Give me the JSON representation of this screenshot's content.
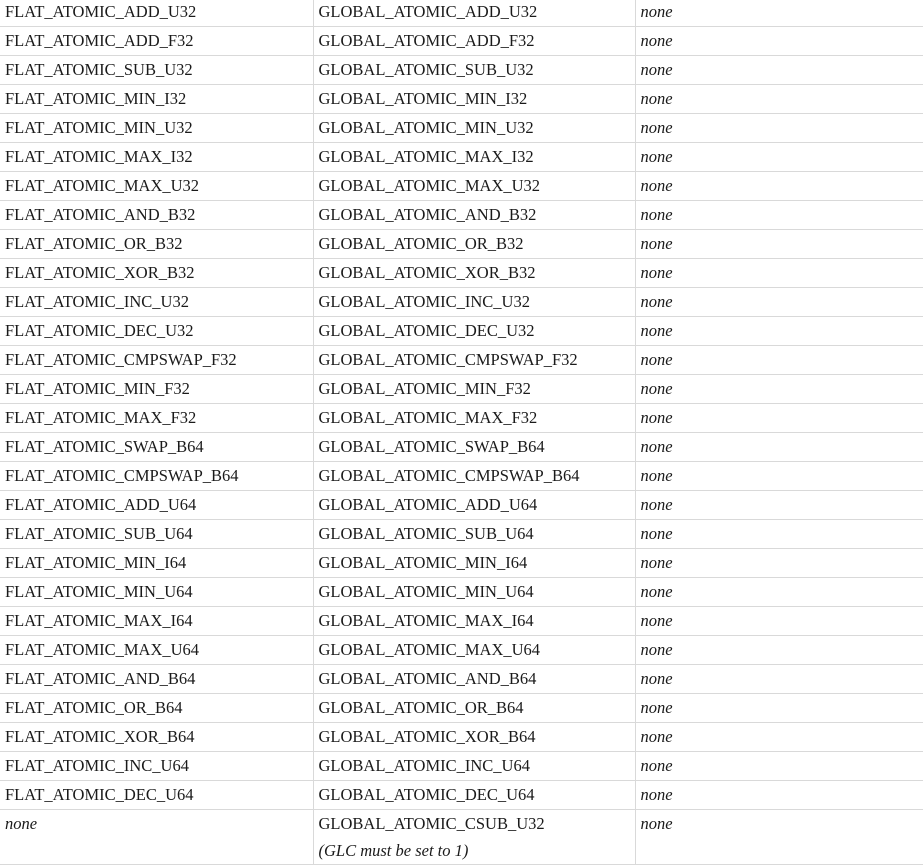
{
  "rows": [
    {
      "flat": "FLAT_ATOMIC_ADD_U32",
      "global": "GLOBAL_ATOMIC_ADD_U32",
      "extra": "none"
    },
    {
      "flat": "FLAT_ATOMIC_ADD_F32",
      "global": "GLOBAL_ATOMIC_ADD_F32",
      "extra": "none"
    },
    {
      "flat": "FLAT_ATOMIC_SUB_U32",
      "global": "GLOBAL_ATOMIC_SUB_U32",
      "extra": "none"
    },
    {
      "flat": "FLAT_ATOMIC_MIN_I32",
      "global": "GLOBAL_ATOMIC_MIN_I32",
      "extra": "none"
    },
    {
      "flat": "FLAT_ATOMIC_MIN_U32",
      "global": "GLOBAL_ATOMIC_MIN_U32",
      "extra": "none"
    },
    {
      "flat": "FLAT_ATOMIC_MAX_I32",
      "global": "GLOBAL_ATOMIC_MAX_I32",
      "extra": "none"
    },
    {
      "flat": "FLAT_ATOMIC_MAX_U32",
      "global": "GLOBAL_ATOMIC_MAX_U32",
      "extra": "none"
    },
    {
      "flat": "FLAT_ATOMIC_AND_B32",
      "global": "GLOBAL_ATOMIC_AND_B32",
      "extra": "none"
    },
    {
      "flat": "FLAT_ATOMIC_OR_B32",
      "global": "GLOBAL_ATOMIC_OR_B32",
      "extra": "none"
    },
    {
      "flat": "FLAT_ATOMIC_XOR_B32",
      "global": "GLOBAL_ATOMIC_XOR_B32",
      "extra": "none"
    },
    {
      "flat": "FLAT_ATOMIC_INC_U32",
      "global": "GLOBAL_ATOMIC_INC_U32",
      "extra": "none"
    },
    {
      "flat": "FLAT_ATOMIC_DEC_U32",
      "global": "GLOBAL_ATOMIC_DEC_U32",
      "extra": "none"
    },
    {
      "flat": "FLAT_ATOMIC_CMPSWAP_F32",
      "global": "GLOBAL_ATOMIC_CMPSWAP_F32",
      "extra": "none"
    },
    {
      "flat": "FLAT_ATOMIC_MIN_F32",
      "global": "GLOBAL_ATOMIC_MIN_F32",
      "extra": "none"
    },
    {
      "flat": "FLAT_ATOMIC_MAX_F32",
      "global": "GLOBAL_ATOMIC_MAX_F32",
      "extra": "none"
    },
    {
      "flat": "FLAT_ATOMIC_SWAP_B64",
      "global": "GLOBAL_ATOMIC_SWAP_B64",
      "extra": "none"
    },
    {
      "flat": "FLAT_ATOMIC_CMPSWAP_B64",
      "global": "GLOBAL_ATOMIC_CMPSWAP_B64",
      "extra": "none"
    },
    {
      "flat": "FLAT_ATOMIC_ADD_U64",
      "global": "GLOBAL_ATOMIC_ADD_U64",
      "extra": "none"
    },
    {
      "flat": "FLAT_ATOMIC_SUB_U64",
      "global": "GLOBAL_ATOMIC_SUB_U64",
      "extra": "none"
    },
    {
      "flat": "FLAT_ATOMIC_MIN_I64",
      "global": "GLOBAL_ATOMIC_MIN_I64",
      "extra": "none"
    },
    {
      "flat": "FLAT_ATOMIC_MIN_U64",
      "global": "GLOBAL_ATOMIC_MIN_U64",
      "extra": "none"
    },
    {
      "flat": "FLAT_ATOMIC_MAX_I64",
      "global": "GLOBAL_ATOMIC_MAX_I64",
      "extra": "none"
    },
    {
      "flat": "FLAT_ATOMIC_MAX_U64",
      "global": "GLOBAL_ATOMIC_MAX_U64",
      "extra": "none"
    },
    {
      "flat": "FLAT_ATOMIC_AND_B64",
      "global": "GLOBAL_ATOMIC_AND_B64",
      "extra": "none"
    },
    {
      "flat": "FLAT_ATOMIC_OR_B64",
      "global": "GLOBAL_ATOMIC_OR_B64",
      "extra": "none"
    },
    {
      "flat": "FLAT_ATOMIC_XOR_B64",
      "global": "GLOBAL_ATOMIC_XOR_B64",
      "extra": "none"
    },
    {
      "flat": "FLAT_ATOMIC_INC_U64",
      "global": "GLOBAL_ATOMIC_INC_U64",
      "extra": "none"
    },
    {
      "flat": "FLAT_ATOMIC_DEC_U64",
      "global": "GLOBAL_ATOMIC_DEC_U64",
      "extra": "none"
    }
  ],
  "last_row": {
    "flat": "none",
    "global": "GLOBAL_ATOMIC_CSUB_U32",
    "global_note": "(GLC must be set to 1)",
    "extra": "none"
  }
}
